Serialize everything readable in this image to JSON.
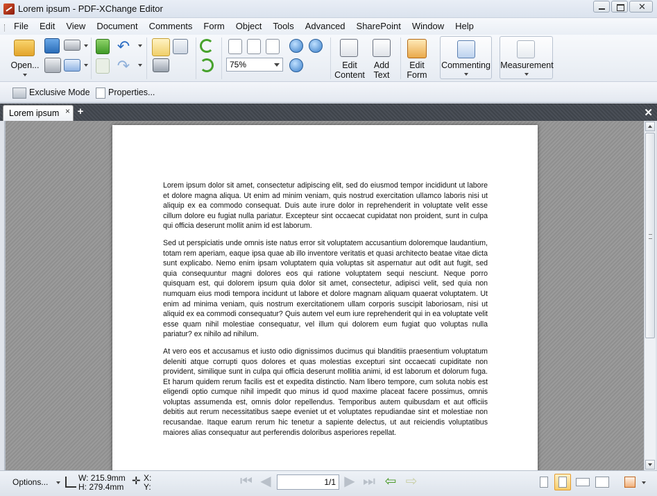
{
  "window": {
    "title": "Lorem ipsum - PDF-XChange Editor",
    "minimize_symbol": "",
    "maximize_symbol": "",
    "close_symbol": "✕"
  },
  "menu": [
    "File",
    "Edit",
    "View",
    "Document",
    "Comments",
    "Form",
    "Object",
    "Tools",
    "Advanced",
    "SharePoint",
    "Window",
    "Help"
  ],
  "toolbar": {
    "open_label": "Open...",
    "zoom_value": "75%",
    "edit_content_label": "Edit\nContent",
    "add_text_label": "Add\nText",
    "edit_form_label": "Edit\nForm",
    "commenting_label": "Commenting",
    "measurement_label": "Measurement"
  },
  "toolbar2": {
    "exclusive_mode": "Exclusive Mode",
    "properties": "Properties..."
  },
  "tabs": {
    "document_tab": "Lorem ipsum",
    "tab_close": "×",
    "add_tab": "+",
    "close_all": "✕"
  },
  "document": {
    "paragraphs": [
      "Lorem ipsum dolor sit amet, consectetur adipiscing elit, sed do eiusmod tempor incididunt ut labore et dolore magna aliqua. Ut enim ad minim veniam, quis nostrud exercitation ullamco laboris nisi ut aliquip ex ea commodo consequat. Duis aute irure dolor in reprehenderit in voluptate velit esse cillum dolore eu fugiat nulla pariatur. Excepteur sint occaecat cupidatat non proident, sunt in culpa qui officia deserunt mollit anim id est laborum.",
      "Sed ut perspiciatis unde omnis iste natus error sit voluptatem accusantium doloremque laudantium, totam rem aperiam, eaque ipsa quae ab illo inventore veritatis et quasi architecto beatae vitae dicta sunt explicabo. Nemo enim ipsam voluptatem quia voluptas sit aspernatur aut odit aut fugit, sed quia consequuntur magni dolores eos qui ratione voluptatem sequi nesciunt. Neque porro quisquam est, qui dolorem ipsum quia dolor sit amet, consectetur, adipisci velit, sed quia non numquam eius modi tempora incidunt ut labore et dolore magnam aliquam quaerat voluptatem. Ut enim ad minima veniam, quis nostrum exercitationem ullam corporis suscipit laboriosam, nisi ut aliquid ex ea commodi consequatur? Quis autem vel eum iure reprehenderit qui in ea voluptate velit esse quam nihil molestiae consequatur, vel illum qui dolorem eum fugiat quo voluptas nulla pariatur? ex nihilo ad nihilum.",
      "At vero eos et accusamus et iusto odio dignissimos ducimus qui blanditiis praesentium voluptatum deleniti atque corrupti quos dolores et quas molestias excepturi sint occaecati cupiditate non provident, similique sunt in culpa qui officia deserunt mollitia animi, id est laborum et dolorum fuga. Et harum quidem rerum facilis est et expedita distinctio. Nam libero tempore, cum soluta nobis est eligendi optio cumque nihil impedit quo minus id quod maxime placeat facere possimus, omnis voluptas assumenda est, omnis dolor repellendus. Temporibus autem quibusdam et aut officiis debitis aut rerum necessitatibus saepe eveniet ut et voluptates repudiandae sint et molestiae non recusandae. Itaque earum rerum hic tenetur a sapiente delectus, ut aut reiciendis voluptatibus maiores alias consequatur aut perferendis doloribus asperiores repellat."
    ]
  },
  "statusbar": {
    "options_label": "Options...",
    "width": "W: 215.9mm",
    "height": "H: 279.4mm",
    "x_label": "X:",
    "y_label": "Y:",
    "page_indicator": "1/1"
  },
  "colors": {
    "accent": "#e39b2e",
    "tab_strip": "#45494f",
    "doc_background": "#959595"
  }
}
